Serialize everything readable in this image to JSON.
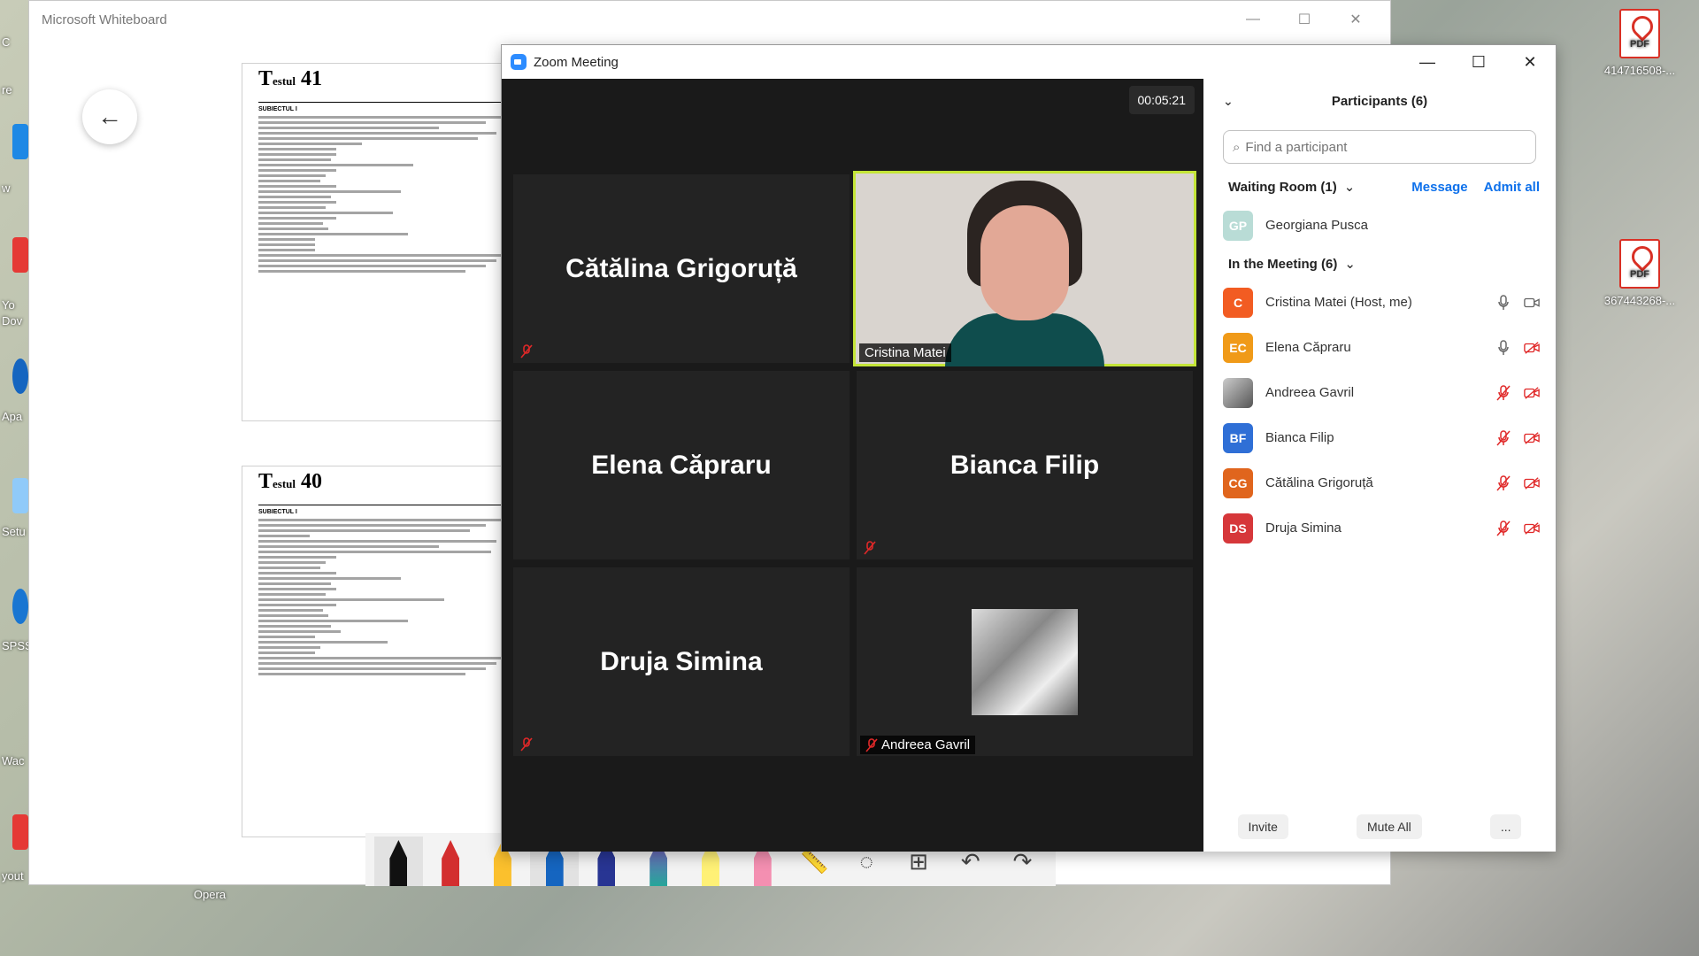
{
  "desktop": {
    "icons": [
      {
        "label": "414716508-..."
      },
      {
        "label": "367443268-..."
      }
    ],
    "left_labels": [
      "C",
      "re",
      "w",
      "Yo",
      "Dov",
      "Apa",
      "Setu",
      "SPSS",
      "Wac",
      "yout"
    ],
    "opera_label": "Opera"
  },
  "whiteboard": {
    "title": "Microsoft Whiteboard",
    "pages": [
      {
        "prefix": "T",
        "small": "estul",
        "number": "41",
        "section": "SUBIECTUL I"
      },
      {
        "prefix": "T",
        "small": "estul",
        "number": "40",
        "section": "SUBIECTUL I"
      }
    ]
  },
  "zoom": {
    "title": "Zoom Meeting",
    "timer": "00:05:21",
    "tiles": [
      {
        "name": "Cătălina Grigoruță",
        "label": ""
      },
      {
        "name": "",
        "label": "Cristina Matei"
      },
      {
        "name": "Elena Căpraru",
        "label": ""
      },
      {
        "name": "Bianca Filip",
        "label": ""
      },
      {
        "name": "Druja Simina",
        "label": ""
      },
      {
        "name": "",
        "label": "Andreea Gavril"
      }
    ],
    "participants_panel": {
      "title": "Participants (6)",
      "search_placeholder": "Find a participant",
      "waiting_room": {
        "label": "Waiting Room (1)",
        "message": "Message",
        "admit_all": "Admit all",
        "people": [
          {
            "initials": "GP",
            "name": "Georgiana Pusca",
            "color": "#b9dcd6"
          }
        ]
      },
      "in_meeting": {
        "label": "In the Meeting (6)",
        "people": [
          {
            "initials": "C",
            "name": "Cristina Matei (Host, me)",
            "color": "#f25c22"
          },
          {
            "initials": "EC",
            "name": "Elena Căpraru",
            "color": "#f09a18"
          },
          {
            "initials": "",
            "name": "Andreea Gavril",
            "color": "#777777"
          },
          {
            "initials": "BF",
            "name": "Bianca Filip",
            "color": "#2f6fd6"
          },
          {
            "initials": "CG",
            "name": "Cătălina Grigoruță",
            "color": "#e0651d"
          },
          {
            "initials": "DS",
            "name": "Druja Simina",
            "color": "#d6373a"
          }
        ]
      },
      "footer": {
        "invite": "Invite",
        "mute_all": "Mute All",
        "more": "..."
      }
    }
  },
  "colors": {
    "zoom_blue": "#0e71eb",
    "muted_red": "#e02828",
    "active_border": "#c4e538"
  }
}
